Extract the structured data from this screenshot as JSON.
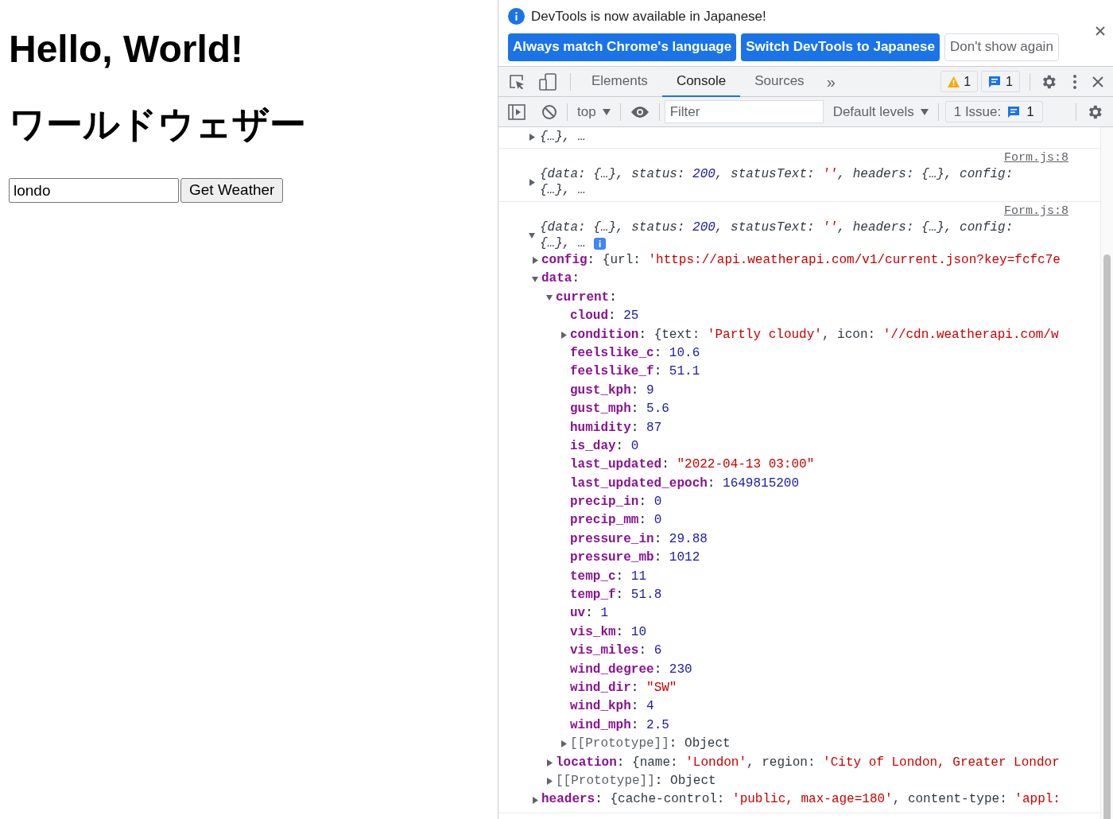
{
  "page": {
    "heading": "Hello, World!",
    "subheading": "ワールドウェザー",
    "city_input": {
      "value": "londo"
    },
    "submit_button": "Get Weather"
  },
  "devtools": {
    "infobar": {
      "message": "DevTools is now available in Japanese!",
      "buttons": [
        {
          "label": "Always match Chrome's language",
          "kind": "primary"
        },
        {
          "label": "Switch DevTools to Japanese",
          "kind": "primary"
        },
        {
          "label": "Don't show again",
          "kind": "secondary"
        }
      ]
    },
    "tabs": [
      {
        "label": "Elements",
        "selected": false
      },
      {
        "label": "Console",
        "selected": true
      },
      {
        "label": "Sources",
        "selected": false
      }
    ],
    "more_tabs": "»",
    "warning_count": "1",
    "message_count": "1",
    "console_toolbar": {
      "context": "top",
      "filter": {
        "placeholder": "Filter"
      },
      "levels": "Default levels",
      "issues_label": "1 Issue:",
      "issues_count": "1"
    },
    "console": {
      "messages": [
        {
          "lines": [
            "{…}, …"
          ],
          "expanded": false,
          "info": false
        },
        {
          "source": "Form.js:8",
          "lines": [
            "{data: {…}, status: 200, statusText: '', headers: {…}, config:",
            "{…}, …"
          ],
          "expanded": false,
          "info": false
        },
        {
          "source": "Form.js:8",
          "lines": [
            "{data: {…}, status: 200, statusText: '', headers: {…}, config:",
            "{…}, …"
          ],
          "expanded": true,
          "info": true,
          "children": [
            {
              "kind": "property",
              "key": "config:",
              "value": "{url: 'https://api.weatherapi.com/v1/current.json?key=fcfc7e",
              "expanded": false
            },
            {
              "kind": "property",
              "key": "data:",
              "expanded": true,
              "children": [
                {
                  "kind": "property",
                  "key": "current:",
                  "expanded": true,
                  "children": [
                    {
                      "kind": "property",
                      "key": "cloud:",
                      "value": "25"
                    },
                    {
                      "kind": "property",
                      "key": "condition:",
                      "value": "{text: 'Partly cloudy', icon: '//cdn.weatherapi.com/w",
                      "expanded": false
                    },
                    {
                      "kind": "property",
                      "key": "feelslike_c:",
                      "value": "10.6"
                    },
                    {
                      "kind": "property",
                      "key": "feelslike_f:",
                      "value": "51.1"
                    },
                    {
                      "kind": "property",
                      "key": "gust_kph:",
                      "value": "9"
                    },
                    {
                      "kind": "property",
                      "key": "gust_mph:",
                      "value": "5.6"
                    },
                    {
                      "kind": "property",
                      "key": "humidity:",
                      "value": "87"
                    },
                    {
                      "kind": "property",
                      "key": "is_day:",
                      "value": "0"
                    },
                    {
                      "kind": "property",
                      "key": "last_updated:",
                      "value": "\"2022-04-13 03:00\""
                    },
                    {
                      "kind": "property",
                      "key": "last_updated_epoch:",
                      "value": "1649815200"
                    },
                    {
                      "kind": "property",
                      "key": "precip_in:",
                      "value": "0"
                    },
                    {
                      "kind": "property",
                      "key": "precip_mm:",
                      "value": "0"
                    },
                    {
                      "kind": "property",
                      "key": "pressure_in:",
                      "value": "29.88"
                    },
                    {
                      "kind": "property",
                      "key": "pressure_mb:",
                      "value": "1012"
                    },
                    {
                      "kind": "property",
                      "key": "temp_c:",
                      "value": "11"
                    },
                    {
                      "kind": "property",
                      "key": "temp_f:",
                      "value": "51.8"
                    },
                    {
                      "kind": "property",
                      "key": "uv:",
                      "value": "1"
                    },
                    {
                      "kind": "property",
                      "key": "vis_km:",
                      "value": "10"
                    },
                    {
                      "kind": "property",
                      "key": "vis_miles:",
                      "value": "6"
                    },
                    {
                      "kind": "property",
                      "key": "wind_degree:",
                      "value": "230"
                    },
                    {
                      "kind": "property",
                      "key": "wind_dir:",
                      "value": "\"SW\""
                    },
                    {
                      "kind": "property",
                      "key": "wind_kph:",
                      "value": "4"
                    },
                    {
                      "kind": "property",
                      "key": "wind_mph:",
                      "value": "2.5"
                    },
                    {
                      "kind": "internal",
                      "key": "[[Prototype]]:",
                      "value": "Object",
                      "expanded": false
                    }
                  ]
                },
                {
                  "kind": "property",
                  "key": "location:",
                  "value": "{name: 'London', region: 'City of London, Greater Londor",
                  "expanded": false
                },
                {
                  "kind": "internal",
                  "key": "[[Prototype]]:",
                  "value": "Object",
                  "expanded": false
                }
              ]
            },
            {
              "kind": "property",
              "key": "headers:",
              "value": "{cache-control: 'public, max-age=180', content-type: 'appl:",
              "expanded": false
            }
          ]
        }
      ]
    }
  }
}
